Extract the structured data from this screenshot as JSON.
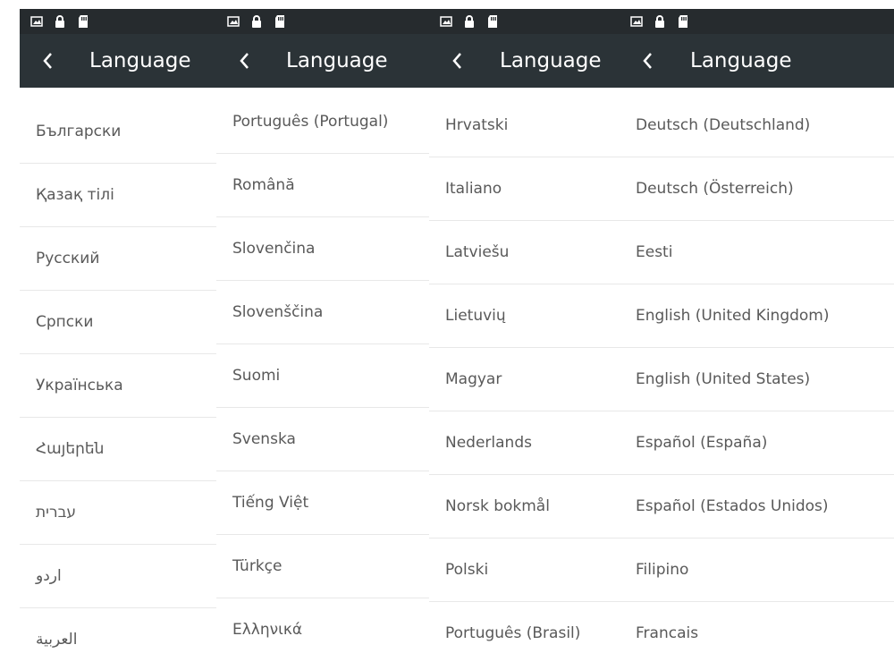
{
  "theme": {
    "statusbar": "#262b2e",
    "appbar": "#2b3337",
    "text": "#595959",
    "divider": "#e8e8e8"
  },
  "status_icons": [
    "image-icon",
    "lock-icon",
    "sd-card-icon"
  ],
  "back_icon": "chevron-left-icon",
  "screens": [
    {
      "title": "Language",
      "items": [
        "Български",
        "Қазақ тілі",
        "Русский",
        "Српски",
        "Українська",
        "Հայերեն",
        "עברית",
        "اردو",
        "العربية"
      ]
    },
    {
      "title": "Language",
      "items": [
        "Português (Portugal)",
        "Română",
        "Slovenčina",
        "Slovenščina",
        "Suomi",
        "Svenska",
        "Tiếng Việt",
        "Türkçe",
        "Ελληνικά"
      ]
    },
    {
      "title": "Language",
      "items": [
        "Hrvatski",
        "Italiano",
        "Latviešu",
        "Lietuvių",
        "Magyar",
        "Nederlands",
        "Norsk bokmål",
        "Polski",
        "Português (Brasil)"
      ]
    },
    {
      "title": "Language",
      "items": [
        "Deutsch (Deutschland)",
        "Deutsch (Österreich)",
        "Eesti",
        "English (United Kingdom)",
        "English (United States)",
        "Español (España)",
        "Español (Estados Unidos)",
        "Filipino",
        "Francais"
      ]
    }
  ]
}
